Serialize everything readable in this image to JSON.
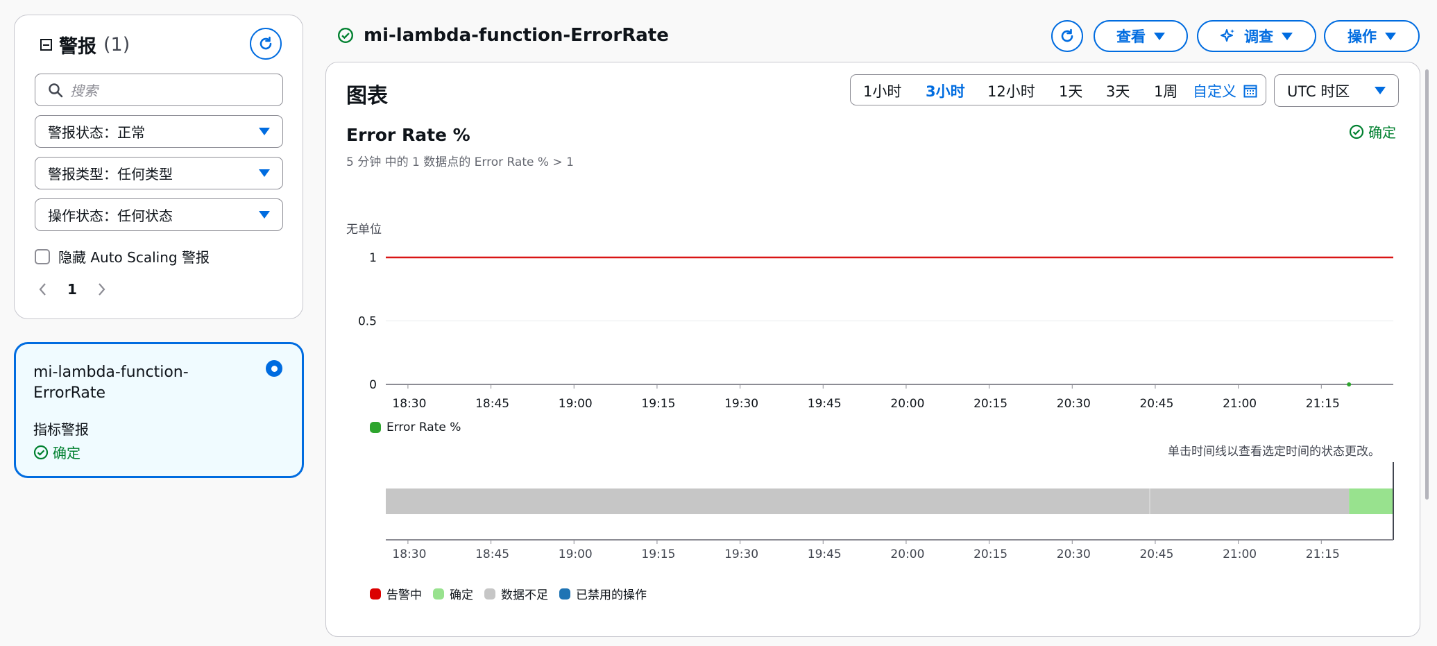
{
  "sidebar": {
    "title": "警报",
    "count": "(1)",
    "search_placeholder": "搜索",
    "filters": [
      {
        "label": "警报状态：正常"
      },
      {
        "label": "警报类型：任何类型"
      },
      {
        "label": "操作状态：任何状态"
      }
    ],
    "hide_autoscaling_label": "隐藏 Auto Scaling 警报",
    "page": "1"
  },
  "alarm_card": {
    "name": "mi-lambda-function-ErrorRate",
    "type": "指标警报",
    "status": "确定"
  },
  "header": {
    "title": "mi-lambda-function-ErrorRate",
    "buttons": {
      "view": "查看",
      "investigate": "调查",
      "actions": "操作"
    }
  },
  "panel": {
    "title": "图表",
    "time_ranges": [
      "1小时",
      "3小时",
      "12小时",
      "1天",
      "3天",
      "1周"
    ],
    "active_range": "3小时",
    "custom_label": "自定义",
    "timezone": "UTC 时区"
  },
  "metric": {
    "title": "Error Rate %",
    "subtitle": "5 分钟 中的 1 数据点的 Error Rate % > 1",
    "status": "确定"
  },
  "timeline": {
    "hint": "单击时间线以查看选定时间的状态更改。",
    "legend": [
      {
        "label": "告警中",
        "color": "#db0000"
      },
      {
        "label": "确定",
        "color": "#98e28e"
      },
      {
        "label": "数据不足",
        "color": "#c6c6c6"
      },
      {
        "label": "已禁用的操作",
        "color": "#1f74b4"
      }
    ]
  },
  "colors": {
    "accent": "#006ce0",
    "ok": "#00802f",
    "threshold": "#d91515",
    "series": "#2ea52e"
  },
  "chart_data": {
    "type": "line",
    "ylabel": "无单位",
    "ylim": [
      0,
      1
    ],
    "yticks": [
      "1",
      "0.5",
      "0"
    ],
    "x_ticks": [
      "18:30",
      "18:45",
      "19:00",
      "19:15",
      "19:30",
      "19:45",
      "20:00",
      "20:15",
      "20:30",
      "20:45",
      "21:00",
      "21:15"
    ],
    "x_range": [
      "18:26",
      "21:28"
    ],
    "threshold": 1,
    "series": [
      {
        "name": "Error Rate %",
        "points": [
          {
            "x": "21:20",
            "y": 0
          }
        ]
      }
    ],
    "state_timeline": [
      {
        "state": "数据不足",
        "from": "18:26",
        "to": "21:20"
      },
      {
        "state": "确定",
        "from": "21:20",
        "to": "21:28"
      }
    ],
    "grid": true,
    "legend_position": "bottom-left"
  }
}
